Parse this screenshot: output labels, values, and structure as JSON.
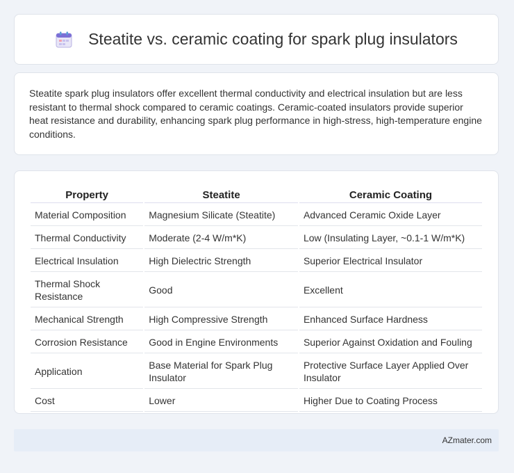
{
  "header": {
    "title": "Steatite vs. ceramic coating for spark plug insulators",
    "icon": "calendar-icon"
  },
  "summary": {
    "text": "Steatite spark plug insulators offer excellent thermal conductivity and electrical insulation but are less resistant to thermal shock compared to ceramic coatings. Ceramic-coated insulators provide superior heat resistance and durability, enhancing spark plug performance in high-stress, high-temperature engine conditions."
  },
  "table": {
    "headers": [
      "Property",
      "Steatite",
      "Ceramic Coating"
    ],
    "rows": [
      [
        "Material Composition",
        "Magnesium Silicate (Steatite)",
        "Advanced Ceramic Oxide Layer"
      ],
      [
        "Thermal Conductivity",
        "Moderate (2-4 W/m*K)",
        "Low (Insulating Layer, ~0.1-1 W/m*K)"
      ],
      [
        "Electrical Insulation",
        "High Dielectric Strength",
        "Superior Electrical Insulator"
      ],
      [
        "Thermal Shock Resistance",
        "Good",
        "Excellent"
      ],
      [
        "Mechanical Strength",
        "High Compressive Strength",
        "Enhanced Surface Hardness"
      ],
      [
        "Corrosion Resistance",
        "Good in Engine Environments",
        "Superior Against Oxidation and Fouling"
      ],
      [
        "Application",
        "Base Material for Spark Plug Insulator",
        "Protective Surface Layer Applied Over Insulator"
      ],
      [
        "Cost",
        "Lower",
        "Higher Due to Coating Process"
      ]
    ]
  },
  "footer": {
    "text": "AZmater.com"
  }
}
